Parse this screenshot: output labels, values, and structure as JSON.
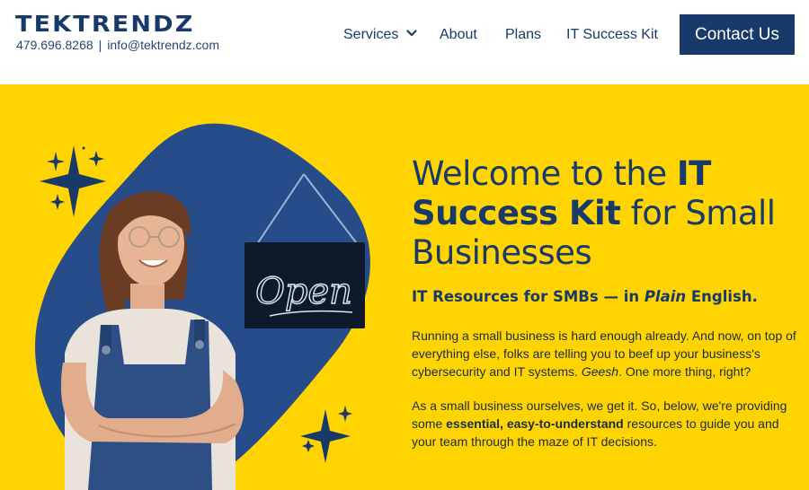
{
  "header": {
    "logo": "TEKTRENDZ",
    "phone": "479.696.8268",
    "separator": "|",
    "email": "info@tektrendz.com",
    "nav": {
      "services": "Services",
      "about": "About",
      "plans": "Plans",
      "it_success_kit": "IT Success Kit"
    },
    "cta_label": "Contact Us"
  },
  "hero": {
    "title_part1": "Welcome to the ",
    "title_bold": "IT Success Kit",
    "title_part2": " for Small Businesses",
    "subtitle_part1": "IT Resources for SMBs — in ",
    "subtitle_italic": "Plain",
    "subtitle_part2": " English.",
    "para1_part1": "Running a small business is hard enough already. And now, on top of everything else, folks are telling you to beef up your business's cybersecurity and IT systems. ",
    "para1_italic": "Geesh",
    "para1_part2": ". One more thing, right?",
    "para2_part1": "As a small business ourselves, we get it. So, below, we're providing some ",
    "para2_bold": "essential, easy-to-understand",
    "para2_part2": " resources to guide you and your team through the maze of IT decisions.",
    "sign_text": "Open"
  },
  "colors": {
    "brand_navy": "#173a6b",
    "hero_yellow": "#ffd400",
    "blob_blue": "#264d8a"
  },
  "icons": {
    "services_dropdown": "chevron-down-icon",
    "sparkles": "sparkle-icon"
  }
}
